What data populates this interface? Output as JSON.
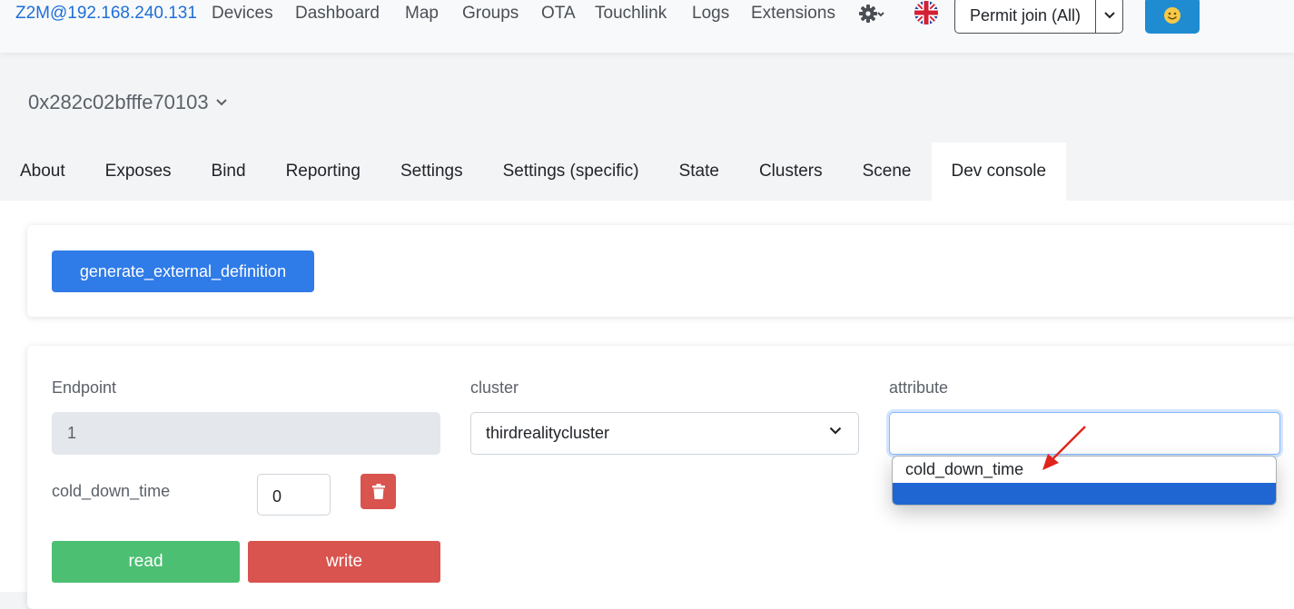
{
  "navbar": {
    "brand": "Z2M@192.168.240.131",
    "links": [
      "Devices",
      "Dashboard",
      "Map",
      "Groups",
      "OTA",
      "Touchlink",
      "Logs",
      "Extensions"
    ],
    "settings_icon": "gear-icon",
    "language_icon": "uk-flag-icon",
    "permit_join_label": "Permit join (All)",
    "user_icon": "smiley-icon"
  },
  "device": {
    "title": "0x282c02bfffe70103"
  },
  "tabs": [
    "About",
    "Exposes",
    "Bind",
    "Reporting",
    "Settings",
    "Settings (specific)",
    "State",
    "Clusters",
    "Scene",
    "Dev console"
  ],
  "active_tab": "Dev console",
  "dev_console": {
    "generate_label": "generate_external_definition",
    "endpoint_label": "Endpoint",
    "endpoint_value": "1",
    "cluster_label": "cluster",
    "cluster_value": "thirdrealitycluster",
    "attribute_label": "attribute",
    "attribute_value": "",
    "attribute_options": [
      "cold_down_time"
    ],
    "attr_row_label": "cold_down_time",
    "attr_row_value": "0",
    "read_label": "read",
    "write_label": "write"
  },
  "colors": {
    "brand": "#1e6fd9",
    "primary": "#2f7be8",
    "success": "#4cbf73",
    "danger": "#d9534f",
    "highlight": "#1f66d2"
  }
}
